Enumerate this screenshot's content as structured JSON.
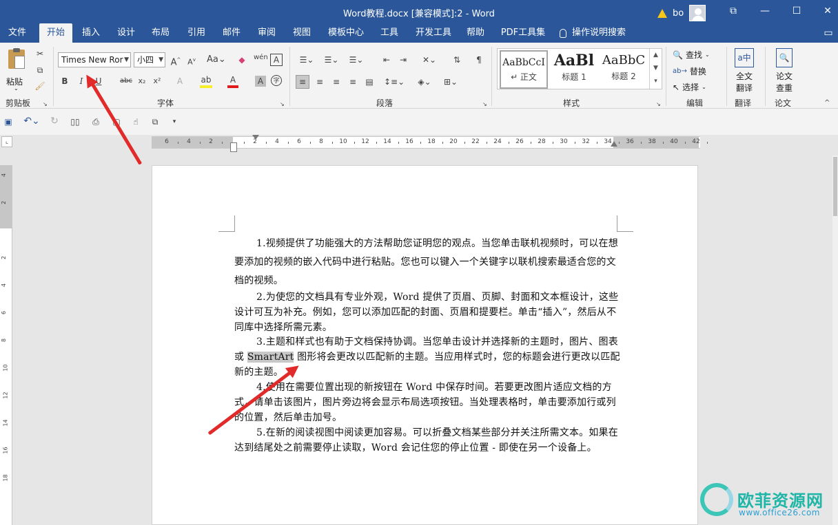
{
  "titlebar": {
    "title": "Word教程.docx [兼容模式]:2  -  Word",
    "user": "bo",
    "controls": [
      "⧉",
      "—",
      "☐",
      "✕"
    ]
  },
  "tabs": [
    "文件",
    "开始",
    "插入",
    "设计",
    "布局",
    "引用",
    "邮件",
    "审阅",
    "视图",
    "模板中心",
    "工具",
    "开发工具",
    "帮助",
    "PDF工具集"
  ],
  "tell_me": "操作说明搜索",
  "ribbon": {
    "clipboard": {
      "paste": "粘贴",
      "label": "剪贴板"
    },
    "font": {
      "name": "Times New Ror",
      "size": "小四",
      "label": "字体"
    },
    "paragraph": {
      "label": "段落"
    },
    "styles": {
      "label": "样式",
      "items": [
        {
          "preview": "AaBbCcI",
          "name": "↵ 正文"
        },
        {
          "preview": "AaBl",
          "name": "标题 1"
        },
        {
          "preview": "AaBbC",
          "name": "标题 2"
        }
      ]
    },
    "editing": {
      "find": "查找",
      "replace": "替换",
      "select": "选择",
      "label": "编辑"
    },
    "translate": {
      "btn1": "全文",
      "btn2": "翻译",
      "label": "翻译"
    },
    "paper": {
      "btn1": "论文",
      "btn2": "查重",
      "label": "论文"
    }
  },
  "ruler": {
    "labels": [
      "6",
      "4",
      "2",
      "",
      "2",
      "4",
      "6",
      "8",
      "10",
      "12",
      "14",
      "16",
      "18",
      "20",
      "22",
      "24",
      "26",
      "28",
      "30",
      "32",
      "34",
      "36",
      "38",
      "40",
      "42"
    ],
    "vlabels": [
      "4",
      "2",
      "",
      "2",
      "4",
      "6",
      "8",
      "10",
      "12",
      "14",
      "16",
      "18"
    ]
  },
  "document": {
    "paragraphs": [
      {
        "id": "p1",
        "text": "1.视频提供了功能强大的方法帮助您证明您的观点。当您单击联机视频时，可以在想要添加的视频的嵌入代码中进行粘贴。您也可以键入一个关键字以联机搜索最适合您的文档的视频。"
      },
      {
        "id": "p2",
        "text": "2.为使您的文档具有专业外观，Word 提供了页眉、页脚、封面和文本框设计，这些设计可互为补充。例如，您可以添加匹配的封面、页眉和提要栏。单击“插入”，然后从不同库中选择所需元素。"
      },
      {
        "id": "p3",
        "before": "3.主题和样式也有助于文档保持协调。当您单击设计并选择新的主题时，图片、图表或 ",
        "highlight": "SmartArt",
        "after": " 图形将会更改以匹配新的主题。当应用样式时，您的标题会进行更改以匹配新的主题。"
      },
      {
        "id": "p4",
        "text": "4.使用在需要位置出现的新按钮在 Word 中保存时间。若要更改图片适应文档的方式，请单击该图片，图片旁边将会显示布局选项按钮。当处理表格时，单击要添加行或列的位置，然后单击加号。"
      },
      {
        "id": "p5",
        "text": "5.在新的阅读视图中阅读更加容易。可以折叠文档某些部分并关注所需文本。如果在达到结尾处之前需要停止读取，Word 会记住您的停止位置 - 即使在另一个设备上。"
      }
    ]
  },
  "watermark": {
    "name": "欧菲资源网",
    "url": "www.office26.com"
  }
}
